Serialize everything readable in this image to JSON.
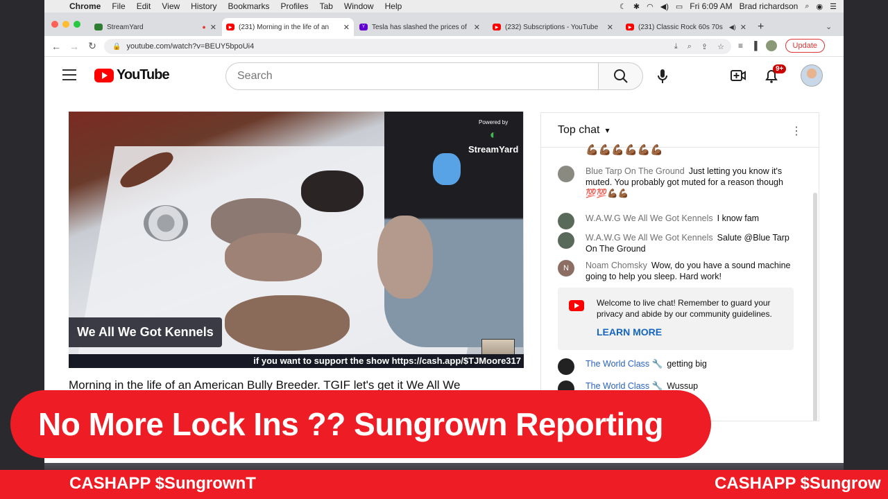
{
  "menubar": {
    "app": "Chrome",
    "items": [
      "File",
      "Edit",
      "View",
      "History",
      "Bookmarks",
      "Profiles",
      "Tab",
      "Window",
      "Help"
    ],
    "clock": "Fri 6:09 AM",
    "user": "Brad richardson"
  },
  "tabs": [
    {
      "title": "StreamYard",
      "color": "#2e7d32"
    },
    {
      "title": "(231) Morning in the life of an",
      "color": "#ff0000"
    },
    {
      "title": "Tesla has slashed the prices of",
      "color": "#6001d2"
    },
    {
      "title": "(232) Subscriptions - YouTube",
      "color": "#ff0000"
    },
    {
      "title": "(231) Classic Rock 60s 70s",
      "color": "#ff0000"
    }
  ],
  "address": {
    "url": "youtube.com/watch?v=BEUY5bpoUi4",
    "update_label": "Update"
  },
  "youtube": {
    "logo_text": "YouTube",
    "search_placeholder": "Search",
    "notification_count": "9+"
  },
  "video": {
    "powered_by": "Powered by",
    "streamyard_logo": "StreamYard",
    "name_label": "We All We Got Kennels",
    "support_text": "if you want to support the show https://cash.app/$TJMoore317",
    "title": "Morning in the life of an American Bully Breeder. TGIF let's get it We All We"
  },
  "chat": {
    "header": "Top chat",
    "messages": [
      {
        "author": "",
        "text": "💪🏾💪🏾💪🏾💪🏾💪🏾💪🏾"
      },
      {
        "author": "Blue Tarp On The Ground",
        "text": "Just letting you know it's muted. You probably got muted for a reason though 💯💯💪🏾💪🏾"
      },
      {
        "author": "W.A.W.G We All We Got Kennels",
        "text": "I know fam"
      },
      {
        "author": "W.A.W.G We All We Got Kennels",
        "text": "Salute @Blue Tarp On The Ground"
      },
      {
        "author": "Noam Chomsky",
        "text": "Wow, do you have a sound machine going to help you sleep. Hard work!"
      },
      {
        "author": "The World Class 🔧",
        "text": "getting big"
      },
      {
        "author": "The World Class 🔧",
        "text": "Wussup"
      }
    ],
    "noam_initial": "N",
    "welcome": "Welcome to live chat! Remember to guard your privacy and abide by our community guidelines.",
    "learn_more": "LEARN MORE"
  },
  "overlay": {
    "headline": "No More Lock Ins ?? Sungrown Reporting",
    "ticker_1": "CASHAPP $SungrownT",
    "ticker_2": "CASHAPP $Sungrow"
  },
  "colors": {
    "overlay_red": "#ee1c24",
    "youtube_red": "#ff0000",
    "link_blue": "#1565c0"
  }
}
